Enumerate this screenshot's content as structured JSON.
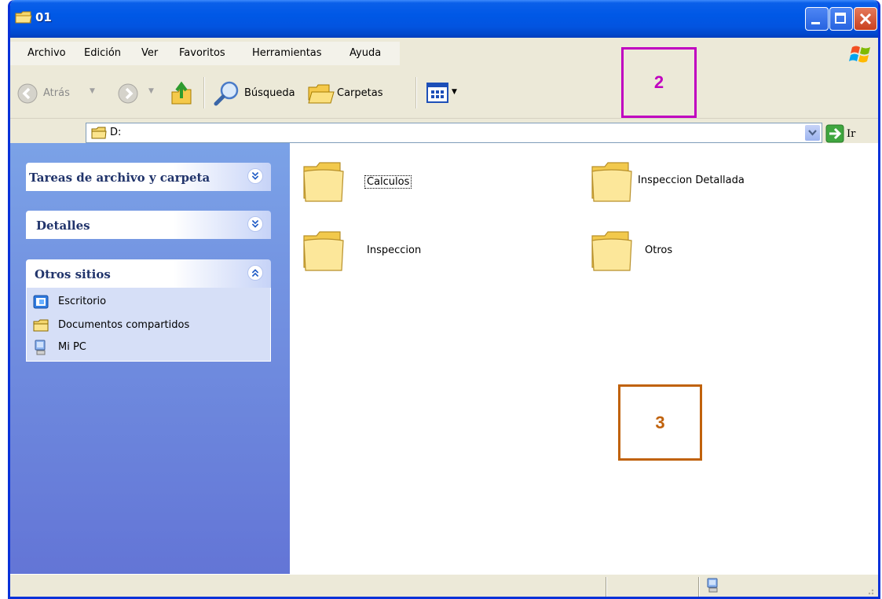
{
  "window": {
    "title": "01"
  },
  "menu": {
    "items": [
      "Archivo",
      "Edición",
      "Ver",
      "Favoritos",
      "Herramientas",
      "Ayuda"
    ]
  },
  "toolbar": {
    "back_label": "Atrás",
    "search_label": "Búsqueda",
    "folders_label": "Carpetas"
  },
  "address": {
    "value": "D:",
    "go_label": "Ir"
  },
  "sidebar": {
    "panels": [
      {
        "title": "Tareas de archivo y carpeta",
        "expanded": false
      },
      {
        "title": "Detalles",
        "expanded": false
      },
      {
        "title": "Otros sitios",
        "expanded": true,
        "links": [
          "Escritorio",
          "Documentos compartidos",
          "Mi PC"
        ]
      }
    ]
  },
  "content": {
    "folders": [
      "Calculos",
      "Inspeccion Detallada",
      "Inspeccion",
      "Otros"
    ]
  },
  "annotations": {
    "callout_2": "2",
    "callout_3": "3"
  },
  "colors": {
    "titlebar": "#0058e6",
    "sidebar_gradient_top": "#7ba2e7",
    "sidebar_gradient_bottom": "#6375d6",
    "panel_title": "#215dc6",
    "callout_2": "#c000c0",
    "callout_3": "#c0620c"
  },
  "icons": {
    "title": "folder-icon",
    "back": "back-arrow-icon",
    "forward": "forward-arrow-icon",
    "up": "folder-up-icon",
    "search": "magnifier-icon",
    "folders": "folders-icon",
    "views": "views-icon",
    "go": "go-arrow-icon",
    "desktop": "desktop-icon",
    "shared": "shared-documents-icon",
    "mypc": "my-computer-icon"
  }
}
